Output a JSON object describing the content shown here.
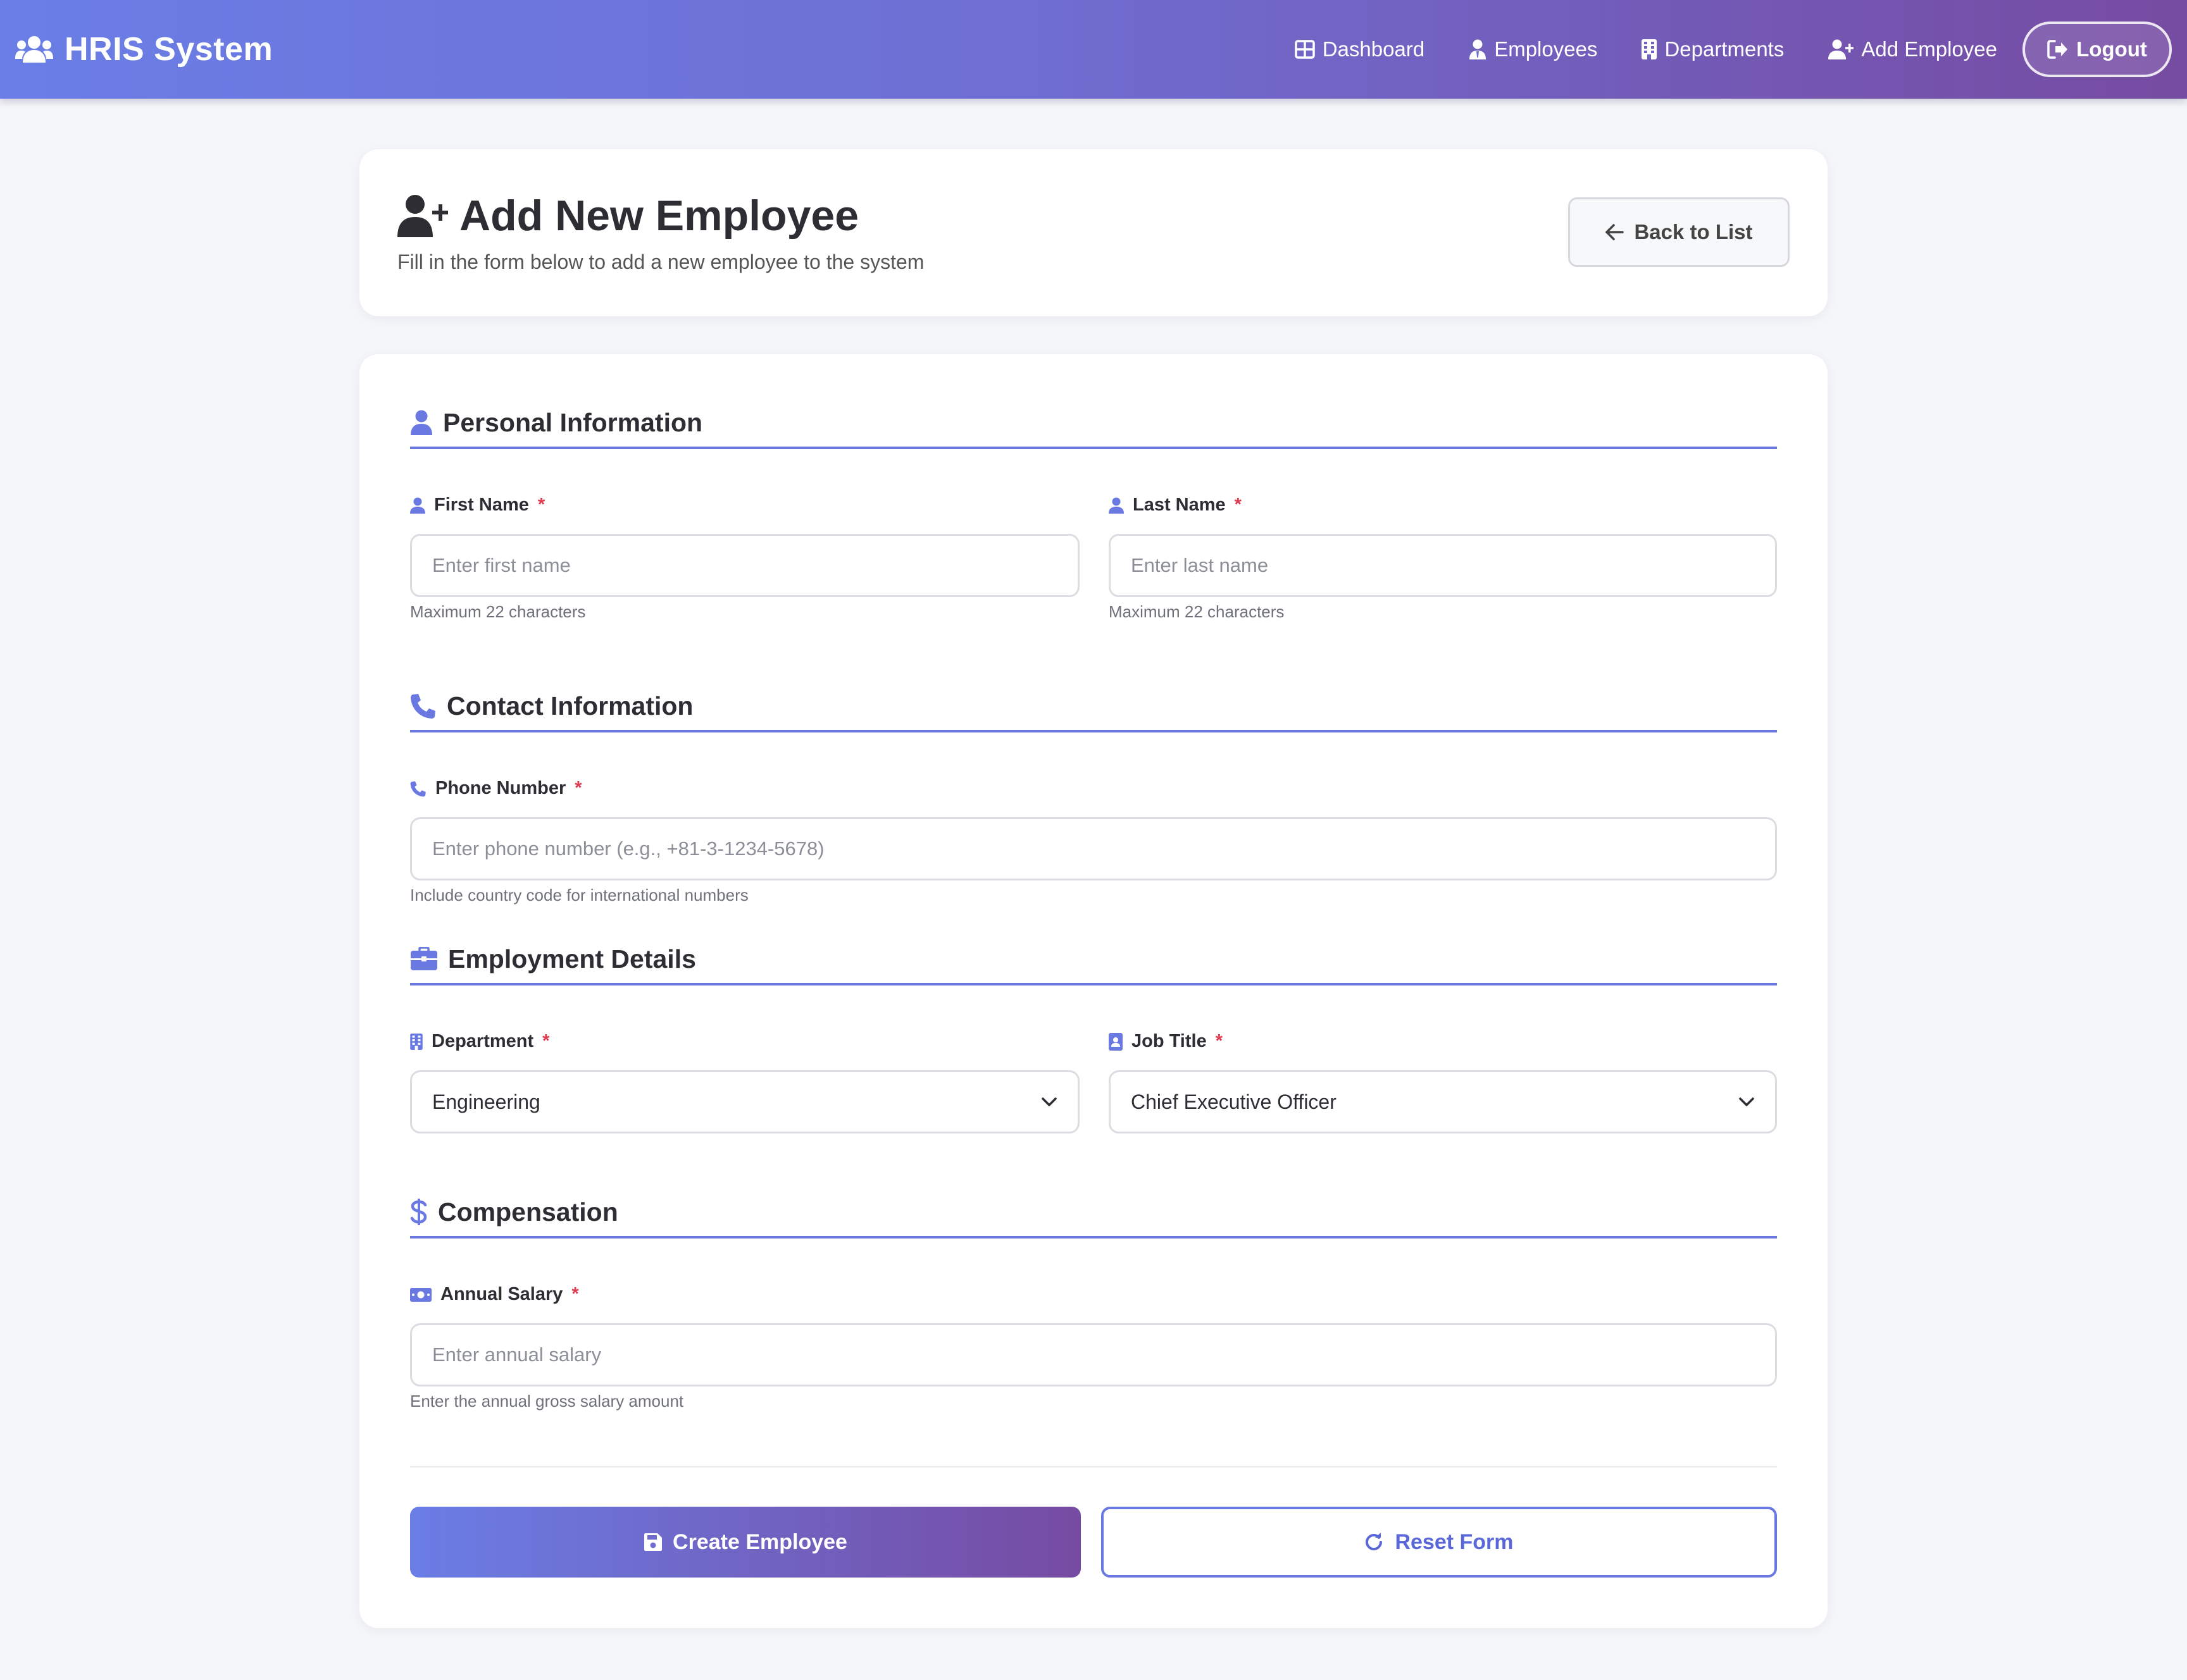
{
  "navbar": {
    "brand": "HRIS System",
    "links": {
      "dashboard": "Dashboard",
      "employees": "Employees",
      "departments": "Departments",
      "add_employee": "Add Employee"
    },
    "logout": "Logout"
  },
  "header": {
    "title": "Add New Employee",
    "subtitle": "Fill in the form below to add a new employee to the system",
    "back_button": "Back to List"
  },
  "sections": {
    "personal": {
      "title": "Personal Information",
      "first_name": {
        "label": "First Name",
        "required_mark": "*",
        "placeholder": "Enter first name",
        "value": "",
        "hint": "Maximum 22 characters"
      },
      "last_name": {
        "label": "Last Name",
        "required_mark": "*",
        "placeholder": "Enter last name",
        "value": "",
        "hint": "Maximum 22 characters"
      }
    },
    "contact": {
      "title": "Contact Information",
      "phone": {
        "label": "Phone Number",
        "required_mark": "*",
        "placeholder": "Enter phone number (e.g., +81-3-1234-5678)",
        "value": "",
        "hint": "Include country code for international numbers"
      }
    },
    "employment": {
      "title": "Employment Details",
      "department": {
        "label": "Department",
        "required_mark": "*",
        "selected": "Engineering"
      },
      "job_title": {
        "label": "Job Title",
        "required_mark": "*",
        "selected": "Chief Executive Officer"
      }
    },
    "compensation": {
      "title": "Compensation",
      "salary": {
        "label": "Annual Salary",
        "required_mark": "*",
        "placeholder": "Enter annual salary",
        "value": "",
        "hint": "Enter the annual gross salary amount"
      }
    }
  },
  "actions": {
    "create": "Create Employee",
    "reset": "Reset Form"
  },
  "colors": {
    "accent": "#6a78e2",
    "gradient_start": "#6a7ee6",
    "gradient_end": "#764ba2",
    "required": "#e03a4e"
  }
}
